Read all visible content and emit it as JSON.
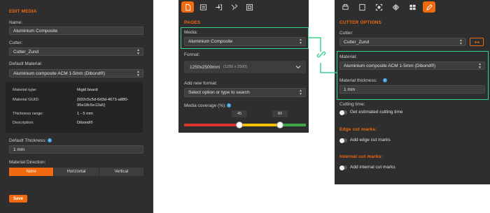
{
  "colors": {
    "accent": "#f26a10",
    "highlight": "#39d28c",
    "panel": "#2e2e2e",
    "info": "#3fa3e0"
  },
  "edit_media": {
    "title": "EDIT MEDIA",
    "name_label": "Name:",
    "name_value": "Aluminium Composite",
    "cutter_label": "Cutter:",
    "cutter_value": "Cutter_Zund",
    "default_material_label": "Default Material:",
    "default_material_value": "Aluminium composite ACM 1-5mm (Dibond®)",
    "details": {
      "material_type_label": "Material type:",
      "material_type_value": "Rigid board",
      "guid_label": "Material GUID:",
      "guid_line1": "{932c5c5d-6d3d-4073-a880-",
      "guid_line2": "95e18c5e12a5}",
      "thickness_range_label": "Thickness range:",
      "thickness_range_value": "1 - 5 mm",
      "description_label": "Description:",
      "description_value": "Dibond®"
    },
    "default_thickness_label": "Default Thickness:",
    "default_thickness_value": "1 mm",
    "direction_label": "Material Direction:",
    "direction_options": [
      "None",
      "Horizontal",
      "Vertical"
    ],
    "direction_selected": "None",
    "save_label": "Save"
  },
  "pages": {
    "toolbar_icons": [
      "document-icon",
      "list-icon",
      "import-icon",
      "tools-icon",
      "frame-icon"
    ],
    "title": "PAGES",
    "media_label": "Media:",
    "media_value": "Aluminium Composite",
    "format_label": "Format:",
    "format_value": "1250x2500mm",
    "format_sub": "(1250 x 2500)",
    "add_format_label": "Add new format:",
    "add_format_placeholder": "Select option or type to search",
    "coverage_label": "Media coverage (%):",
    "coverage_low": "45",
    "coverage_high": "80"
  },
  "cutter_options": {
    "toolbar_icons": [
      "printer-icon",
      "page-icon",
      "fit-icon",
      "mirror-icon",
      "grid-icon",
      "pen-icon"
    ],
    "title": "CUTTER OPTIONS",
    "cutter_label": "Cutter:",
    "cutter_value": "Cutter_Zund",
    "material_label": "Material:",
    "material_value": "Aluminium composite ACM 1-5mm (Dibond®)",
    "thickness_label": "Material thickness:",
    "thickness_value": "1 mm",
    "cutting_time_label": "Cutting time:",
    "cutting_time_toggle": "Get estimated cutting time",
    "edge_title": "Edge cut marks:",
    "edge_toggle": "Add edge cut marks",
    "internal_title": "Internal cut marks:",
    "internal_toggle": "Add internal cut marks"
  }
}
